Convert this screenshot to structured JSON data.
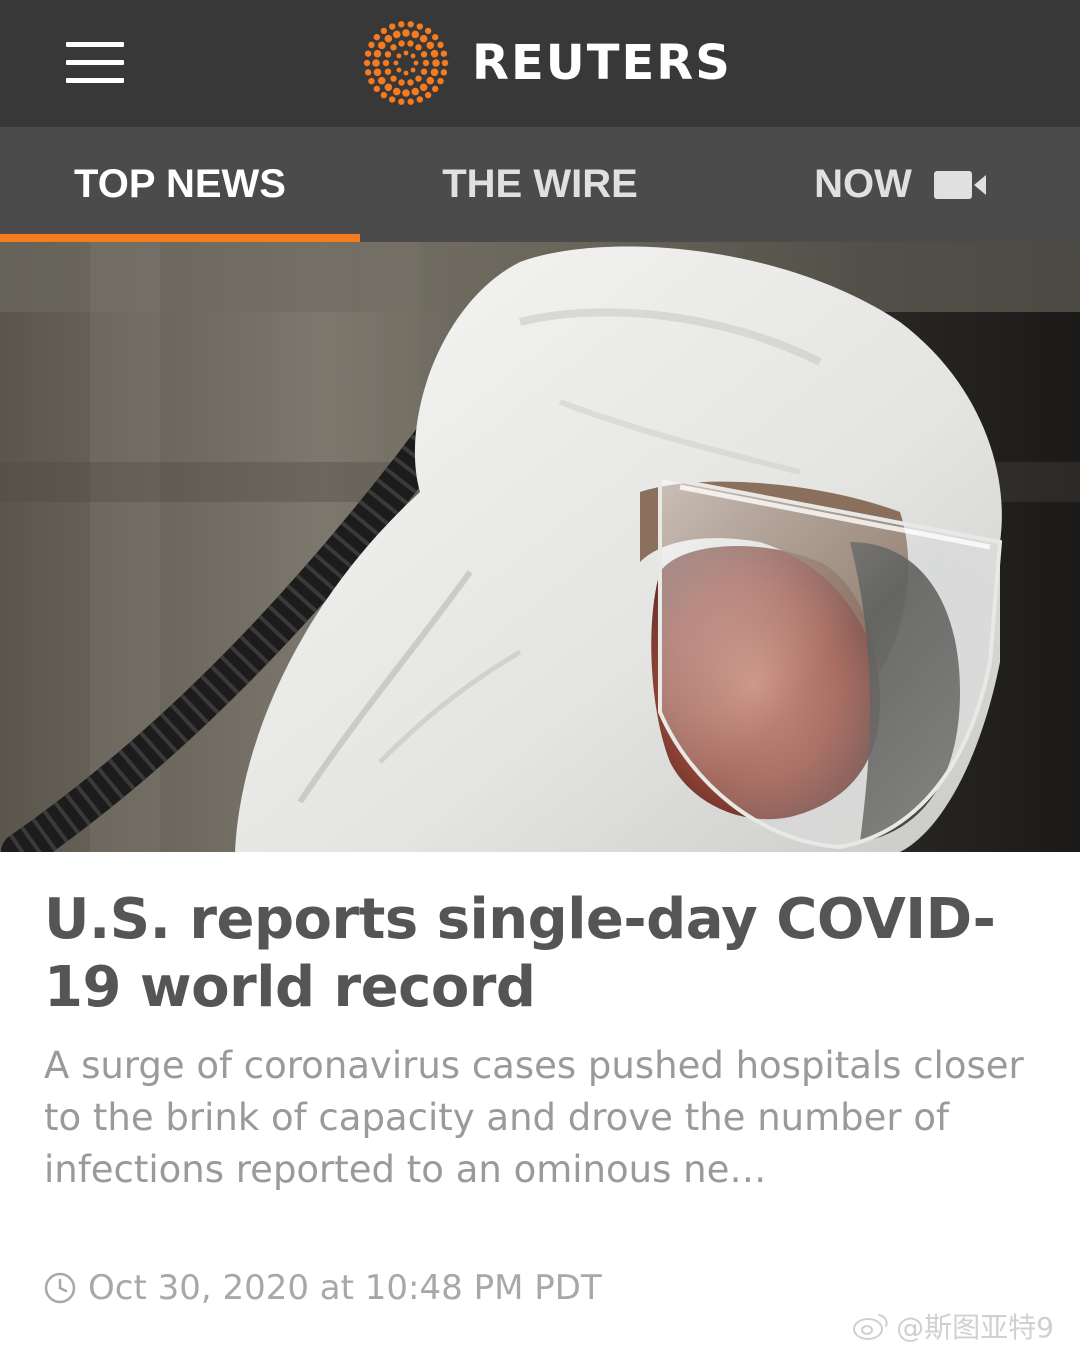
{
  "app": {
    "brand": "REUTERS",
    "accent_color": "#f47b20",
    "header_bg": "#383838",
    "tabs_bg": "#4b4b4b"
  },
  "header": {
    "menu_icon": "hamburger-menu-icon",
    "logo_icon": "reuters-dot-logo-icon"
  },
  "tabs": [
    {
      "label": "TOP NEWS",
      "active": true
    },
    {
      "label": "THE WIRE",
      "active": false
    },
    {
      "label": "NOW",
      "active": false,
      "icon": "video-camera-icon"
    }
  ],
  "article": {
    "headline": "U.S. reports single-day COVID-19 world record",
    "summary": "A surge of coronavirus cases pushed hospitals closer to the brink of capacity and drove the number of infections reported to an ominous ne…",
    "timestamp": "Oct 30, 2020 at 10:48 PM PDT",
    "timestamp_icon": "clock-icon"
  },
  "watermark": {
    "text": "@斯图亚特9",
    "icon": "weibo-icon"
  }
}
